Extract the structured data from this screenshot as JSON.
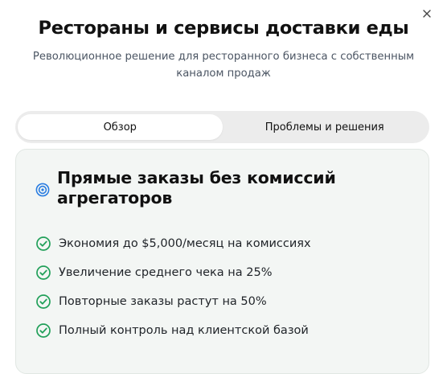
{
  "header": {
    "title": "Рестораны и сервисы доставки еды",
    "subtitle": "Революционное решение для ресторанного бизнеса с собственным каналом продаж"
  },
  "tabs": [
    {
      "label": "Обзор",
      "active": true
    },
    {
      "label": "Проблемы и решения",
      "active": false
    }
  ],
  "card": {
    "icon": "target-icon",
    "title": "Прямые заказы без комиссий агрегаторов",
    "features": [
      "Экономия до $5,000/месяц на комиссиях",
      "Увеличение среднего чека на 25%",
      "Повторные заказы растут на 50%",
      "Полный контроль над клиентской базой"
    ]
  },
  "colors": {
    "accent_blue": "#2a7de1",
    "check_green": "#22a05a",
    "card_bg": "#f3f6f4",
    "tabs_bg": "#ececec"
  }
}
